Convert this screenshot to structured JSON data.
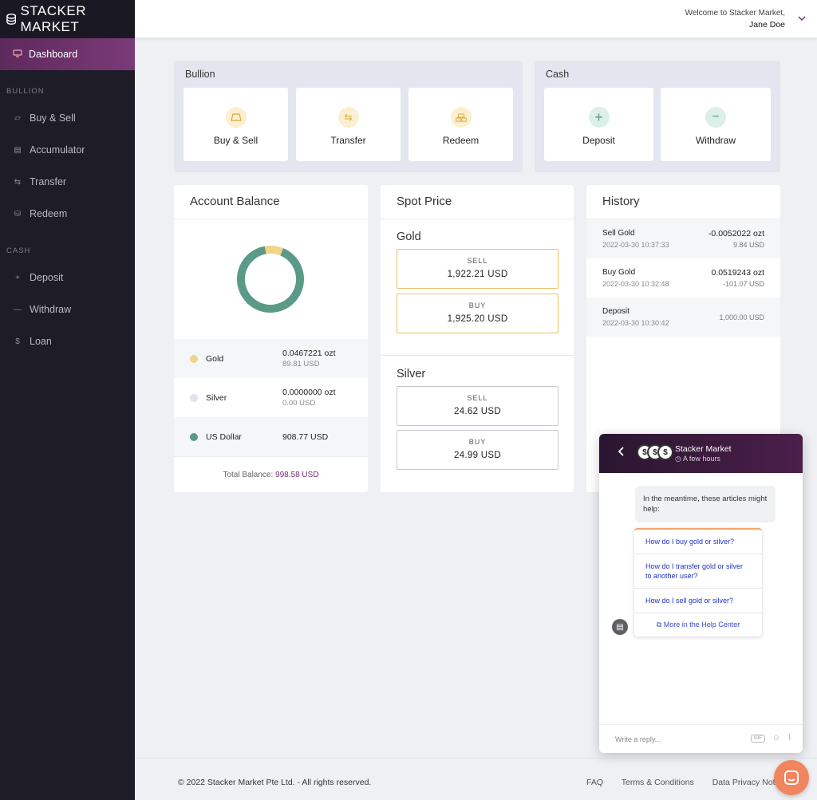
{
  "brand": {
    "name": "STACKER MARKET"
  },
  "sidebar": {
    "active": {
      "label": "Dashboard"
    },
    "sections": [
      {
        "title": "BULLION",
        "items": [
          {
            "label": "Buy & Sell"
          },
          {
            "label": "Accumulator"
          },
          {
            "label": "Transfer"
          },
          {
            "label": "Redeem"
          }
        ]
      },
      {
        "title": "CASH",
        "items": [
          {
            "label": "Deposit"
          },
          {
            "label": "Withdraw"
          },
          {
            "label": "Loan"
          }
        ]
      }
    ]
  },
  "header": {
    "welcome": "Welcome to Stacker Market,",
    "user": "Jane Doe"
  },
  "bullion_panel": {
    "title": "Bullion",
    "actions": [
      {
        "label": "Buy & Sell"
      },
      {
        "label": "Transfer"
      },
      {
        "label": "Redeem"
      }
    ]
  },
  "cash_panel": {
    "title": "Cash",
    "actions": [
      {
        "label": "Deposit"
      },
      {
        "label": "Withdraw"
      }
    ]
  },
  "account_balance": {
    "title": "Account Balance",
    "rows": [
      {
        "label": "Gold",
        "value": "0.0467221 ozt",
        "sub": "89.81 USD",
        "color": "#f0d487"
      },
      {
        "label": "Silver",
        "value": "0.0000000 ozt",
        "sub": "0.00 USD",
        "color": "#dfe3ea"
      },
      {
        "label": "US Dollar",
        "value": "908.77 USD",
        "sub": "",
        "color": "#5a9a86"
      }
    ],
    "total_label": "Total Balance:",
    "total_value": "998.58 USD",
    "donut_fraction": {
      "gold": 0.09,
      "usd": 0.91
    }
  },
  "spot_price": {
    "title": "Spot Price",
    "gold": {
      "title": "Gold",
      "sell_label": "SELL",
      "sell": "1,922.21 USD",
      "buy_label": "BUY",
      "buy": "1,925.20 USD"
    },
    "silver": {
      "title": "Silver",
      "sell_label": "SELL",
      "sell": "24.62 USD",
      "buy_label": "BUY",
      "buy": "24.99 USD"
    }
  },
  "history": {
    "title": "History",
    "rows": [
      {
        "type": "Sell Gold",
        "date": "2022-03-30 10:37:33",
        "amount": "-0.0052022 ozt",
        "usd": "9.84 USD"
      },
      {
        "type": "Buy Gold",
        "date": "2022-03-30 10:32:48",
        "amount": "0.0519243 ozt",
        "usd": "-101.07 USD"
      },
      {
        "type": "Deposit",
        "date": "2022-03-30 10:30:42",
        "amount": "",
        "usd": "1,000.00 USD"
      }
    ]
  },
  "chat": {
    "name": "Stacker Market",
    "status": "A few hours",
    "message": "In the meantime, these articles might help:",
    "articles": [
      "How do I buy gold or silver?",
      "How do I transfer gold or silver to another user?",
      "How do I sell gold or silver?"
    ],
    "more": "More in the Help Center",
    "placeholder": "Write a reply...",
    "gif": "GIF"
  },
  "footer": {
    "copyright": "© 2022 Stacker Market Pte Ltd. - All rights reserved.",
    "links": [
      "FAQ",
      "Terms & Conditions",
      "Data Privacy Notice"
    ]
  }
}
